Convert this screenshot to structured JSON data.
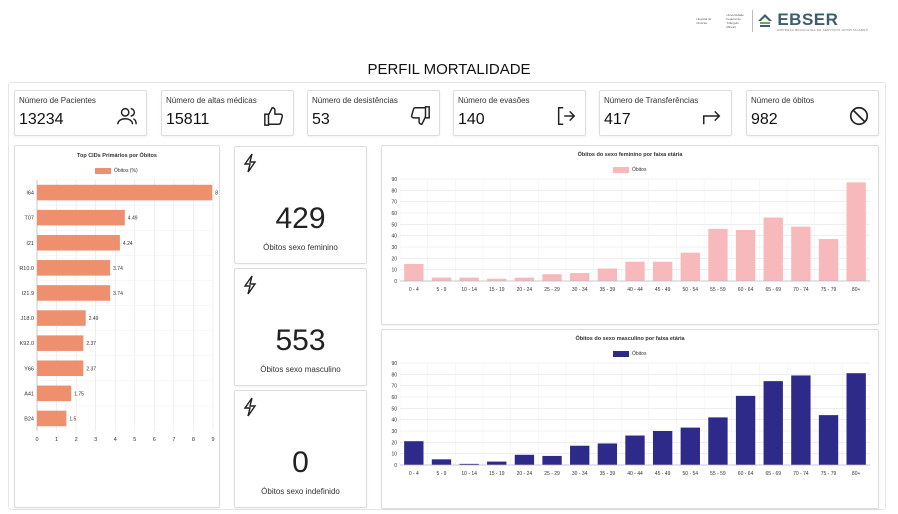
{
  "header": {
    "logo_small_text": "Hospital de Clínicas",
    "logo_small_text2": "Universidade Federal do Triângulo Mineiro",
    "logo_word": "EBSER",
    "logo_subtitle": "EMPRESA BRASILEIRA DE SERVIÇOS HOSPITALARES",
    "page_title": "PERFIL MORTALIDADE"
  },
  "kpis": [
    {
      "label": "Número de Pacientes",
      "value": "13234",
      "icon": "users-icon"
    },
    {
      "label": "Número de altas médicas",
      "value": "15811",
      "icon": "thumbs-up-icon"
    },
    {
      "label": "Número de desistências",
      "value": "53",
      "icon": "thumbs-down-icon"
    },
    {
      "label": "Número de evasões",
      "value": "140",
      "icon": "exit-icon"
    },
    {
      "label": "Número de Transferências",
      "value": "417",
      "icon": "arrow-turn-right-icon"
    },
    {
      "label": "Número de óbitos",
      "value": "982",
      "icon": "ban-icon"
    }
  ],
  "cards": [
    {
      "value": "429",
      "label": "Óbitos sexo feminino",
      "icon": "lightning-icon"
    },
    {
      "value": "553",
      "label": "Óbitos sexo masculino",
      "icon": "lightning-icon"
    },
    {
      "value": "0",
      "label": "Óbitos sexo indefinido",
      "icon": "lightning-icon"
    }
  ],
  "colors": {
    "cid_bar": "#ee8f6e",
    "female_bar": "#f7b9bb",
    "male_bar": "#2d2a8a",
    "logo": "#3d5f6b"
  },
  "chart_data": [
    {
      "type": "bar",
      "orientation": "horizontal",
      "title": "Top CIDs Primários por Óbitos",
      "legend": "Óbitos (%)",
      "categories": [
        "I64",
        "T07",
        "I21",
        "R10.0",
        "I21.9",
        "J18.0",
        "K92.0",
        "Y66",
        "A41",
        "B24"
      ],
      "values": [
        8.96,
        4.49,
        4.24,
        3.74,
        3.74,
        2.49,
        2.37,
        2.37,
        1.75,
        1.5
      ],
      "labels": [
        "8",
        "4.49",
        "4.24",
        "3.74",
        "3.74",
        "2.49",
        "2.37",
        "2.37",
        "1.75",
        "1.5"
      ],
      "xlim": [
        0,
        9
      ],
      "xticks": [
        "0",
        "1",
        "2",
        "3",
        "4",
        "5",
        "6",
        "7",
        "8",
        "9"
      ]
    },
    {
      "type": "bar",
      "title": "Óbitos do sexo feminino por faixa etária",
      "legend": "Óbitos",
      "categories": [
        "0 - 4",
        "5 - 9",
        "10 - 14",
        "15 - 19",
        "20 - 24",
        "25 - 29",
        "30 - 34",
        "35 - 39",
        "40 - 44",
        "45 - 49",
        "50 - 54",
        "55 - 59",
        "60 - 64",
        "65 - 69",
        "70 - 74",
        "75 - 79",
        "80+"
      ],
      "values": [
        15,
        3,
        3,
        2,
        3,
        6,
        7,
        11,
        17,
        17,
        25,
        46,
        45,
        56,
        48,
        37,
        87
      ],
      "ylim": [
        0,
        90
      ],
      "yticks": [
        "0",
        "10",
        "20",
        "30",
        "40",
        "50",
        "60",
        "70",
        "80",
        "90"
      ]
    },
    {
      "type": "bar",
      "title": "Óbitos do sexo masculino por faixa etária",
      "legend": "Óbitos",
      "categories": [
        "0 - 4",
        "5 - 9",
        "10 - 14",
        "15 - 19",
        "20 - 24",
        "25 - 29",
        "30 - 34",
        "35 - 39",
        "40 - 44",
        "45 - 49",
        "50 - 54",
        "55 - 59",
        "60 - 64",
        "65 - 69",
        "70 - 74",
        "75 - 79",
        "80+"
      ],
      "values": [
        21,
        5,
        1,
        3,
        9,
        8,
        17,
        19,
        26,
        30,
        33,
        42,
        61,
        74,
        79,
        44,
        81
      ],
      "ylim": [
        0,
        90
      ],
      "yticks": [
        "0",
        "10",
        "20",
        "30",
        "40",
        "50",
        "60",
        "70",
        "80",
        "90"
      ]
    }
  ]
}
